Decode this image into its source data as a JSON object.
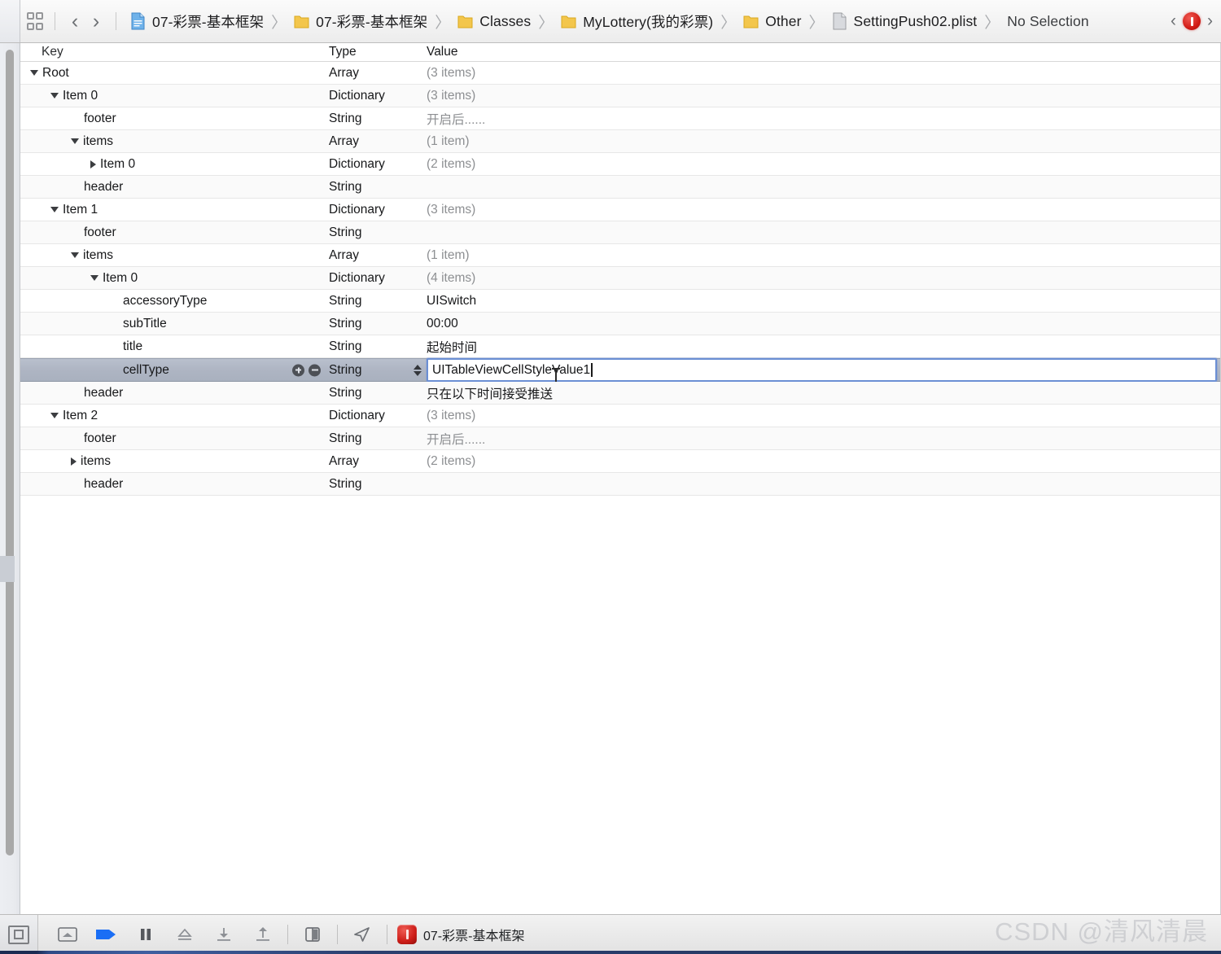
{
  "jumpbar": {
    "grid_icon": "grid-icon",
    "back_label": "‹",
    "forward_label": "›",
    "breadcrumbs": [
      {
        "label": "07-彩票-基本框架",
        "icon": "project-file-icon"
      },
      {
        "label": "07-彩票-基本框架",
        "icon": "folder-icon"
      },
      {
        "label": "Classes",
        "icon": "folder-icon"
      },
      {
        "label": "MyLottery(我的彩票)",
        "icon": "folder-icon"
      },
      {
        "label": "Other",
        "icon": "folder-icon"
      },
      {
        "label": "SettingPush02.plist",
        "icon": "plist-file-icon"
      },
      {
        "label": "No Selection",
        "icon": ""
      }
    ],
    "separator": "〉",
    "issue_prev": "‹",
    "issue_next": "›",
    "issue_badge": "!"
  },
  "table": {
    "columns": [
      "Key",
      "Type",
      "Value"
    ],
    "rows": [
      {
        "key": "Root",
        "indent": 0,
        "tri": "open",
        "type": "Array",
        "value": "(3 items)",
        "muted": true
      },
      {
        "key": "Item 0",
        "indent": 1,
        "tri": "open",
        "type": "Dictionary",
        "value": "(3 items)",
        "muted": true
      },
      {
        "key": "footer",
        "indent": 2,
        "tri": "none",
        "type": "String",
        "value": "开启后......",
        "muted": true
      },
      {
        "key": "items",
        "indent": 2,
        "tri": "open",
        "type": "Array",
        "value": "(1 item)",
        "muted": true
      },
      {
        "key": "Item 0",
        "indent": 3,
        "tri": "closed",
        "type": "Dictionary",
        "value": "(2 items)",
        "muted": true
      },
      {
        "key": "header",
        "indent": 2,
        "tri": "none",
        "type": "String",
        "value": "",
        "muted": false
      },
      {
        "key": "Item 1",
        "indent": 1,
        "tri": "open",
        "type": "Dictionary",
        "value": "(3 items)",
        "muted": true
      },
      {
        "key": "footer",
        "indent": 2,
        "tri": "none",
        "type": "String",
        "value": "",
        "muted": false
      },
      {
        "key": "items",
        "indent": 2,
        "tri": "open",
        "type": "Array",
        "value": "(1 item)",
        "muted": true
      },
      {
        "key": "Item 0",
        "indent": 3,
        "tri": "open",
        "type": "Dictionary",
        "value": "(4 items)",
        "muted": true
      },
      {
        "key": "accessoryType",
        "indent": 4,
        "tri": "none",
        "type": "String",
        "value": "UISwitch",
        "muted": false
      },
      {
        "key": "subTitle",
        "indent": 4,
        "tri": "none",
        "type": "String",
        "value": "00:00",
        "muted": false
      },
      {
        "key": "title",
        "indent": 4,
        "tri": "none",
        "type": "String",
        "value": "起始时间",
        "muted": false
      },
      {
        "key": "cellType",
        "indent": 4,
        "tri": "none",
        "type": "String",
        "value": "UITableViewCellStyleValue1",
        "muted": false,
        "selected": true,
        "editing": true
      },
      {
        "key": "header",
        "indent": 2,
        "tri": "none",
        "type": "String",
        "value": "只在以下时间接受推送",
        "muted": false
      },
      {
        "key": "Item 2",
        "indent": 1,
        "tri": "open",
        "type": "Dictionary",
        "value": "(3 items)",
        "muted": true
      },
      {
        "key": "footer",
        "indent": 2,
        "tri": "none",
        "type": "String",
        "value": "开启后......",
        "muted": true
      },
      {
        "key": "items",
        "indent": 2,
        "tri": "closed",
        "type": "Array",
        "value": "(2 items)",
        "muted": true
      },
      {
        "key": "header",
        "indent": 2,
        "tri": "none",
        "type": "String",
        "value": "",
        "muted": false
      }
    ],
    "selected_row_controls": {
      "add_button": "add-row-button",
      "remove_button": "remove-row-button",
      "type_stepper": "type-stepper"
    }
  },
  "debugbar": {
    "corner_icon": "hide-debug-area-icon",
    "buttons": [
      {
        "name": "breakpoint-toggle-icon",
        "glyph": "breakpoints"
      },
      {
        "name": "continue-execution-icon",
        "glyph": "continue"
      },
      {
        "name": "pause-icon",
        "glyph": "pause"
      },
      {
        "name": "step-over-icon",
        "glyph": "step-over"
      },
      {
        "name": "step-into-icon",
        "glyph": "step-into"
      },
      {
        "name": "step-out-icon",
        "glyph": "step-out"
      },
      {
        "name": "view-debugging-icon",
        "glyph": "view-debug"
      },
      {
        "name": "location-simulate-icon",
        "glyph": "location"
      }
    ],
    "scheme": {
      "app_icon": "app-icon",
      "label": "07-彩票-基本框架"
    }
  },
  "watermark": {
    "text": "CSDN @清风清晨"
  },
  "colors": {
    "selection": "#aeb5c3",
    "edit_border": "#6b8fd4",
    "error_red": "#d11a14",
    "folder_yellow": "#f3c64c",
    "muted_text": "#8d8f92"
  }
}
